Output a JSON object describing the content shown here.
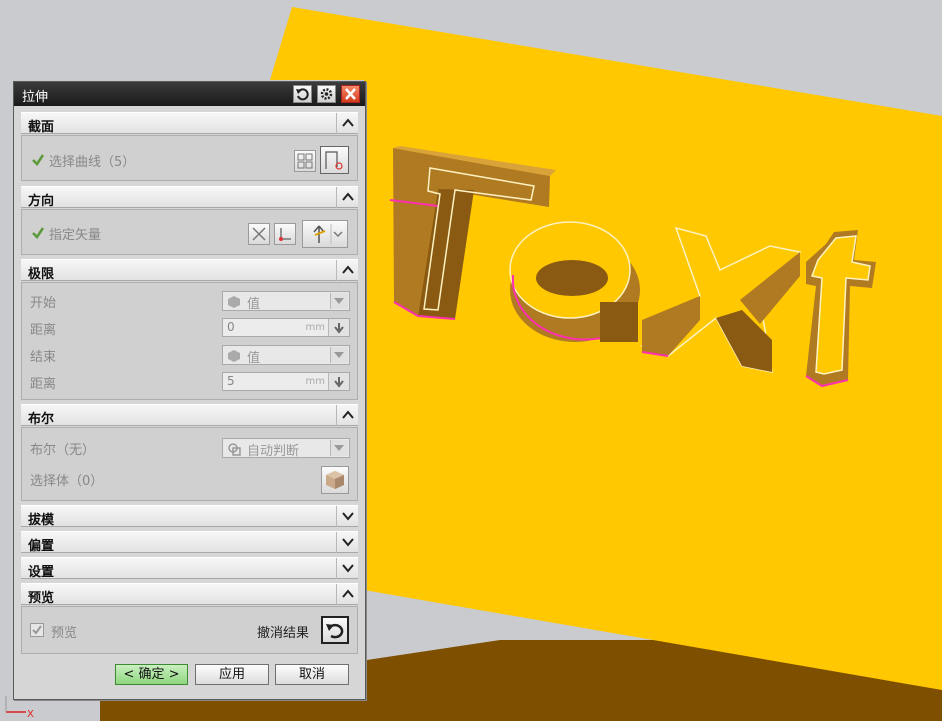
{
  "dialog": {
    "title": "拉伸",
    "sections": {
      "section": {
        "label": "截面"
      },
      "direction": {
        "label": "方向"
      },
      "limits": {
        "label": "极限"
      },
      "boolean": {
        "label": "布尔"
      },
      "draft": {
        "label": "拔模"
      },
      "offset": {
        "label": "偏置"
      },
      "settings": {
        "label": "设置"
      },
      "preview": {
        "label": "预览"
      }
    },
    "section_select_curve": "选择曲线（5）",
    "direction_specify_vector": "指定矢量",
    "limits": {
      "start_label": "开始",
      "start_value": "值",
      "start_distance_label": "距离",
      "start_distance_value": "0",
      "end_label": "结束",
      "end_value": "值",
      "end_distance_label": "距离",
      "end_distance_value": "5",
      "unit": "mm"
    },
    "boolean": {
      "label": "布尔（无）",
      "value": "自动判断",
      "select_body_label": "选择体（0）"
    },
    "preview": {
      "checkbox_label": "预览",
      "checked": true,
      "undo_result_label": "撤消结果"
    },
    "buttons": {
      "ok": "< 确定 >",
      "apply": "应用",
      "cancel": "取消"
    }
  },
  "viewport": {
    "model_text": "Text",
    "axis_label": "X",
    "colors": {
      "background": "#c9cbce",
      "plane": "#ffc800",
      "plane_edge": "#7f4f00",
      "extrusion_side": "#b07a22",
      "highlight": "#ff2fb0"
    }
  }
}
